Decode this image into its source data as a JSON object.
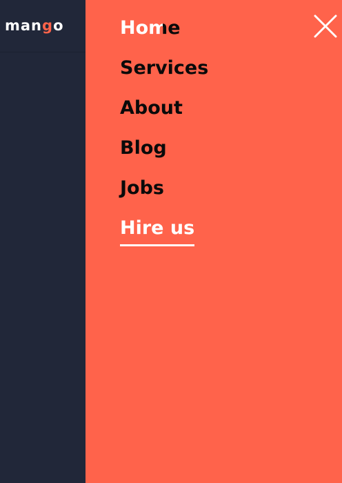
{
  "brand": {
    "logo_prefix": "man",
    "logo_accent": "g",
    "logo_suffix": "o",
    "accent_color": "#ff634a"
  },
  "menu": {
    "background_color": "#ff634b",
    "items": [
      {
        "label": "Home"
      },
      {
        "label": "Services"
      },
      {
        "label": "About"
      },
      {
        "label": "Blog"
      },
      {
        "label": "Jobs"
      },
      {
        "label": "Hire us",
        "active": true
      }
    ],
    "close_icon": "close-icon"
  },
  "sidebar": {
    "background_color": "#212739"
  }
}
